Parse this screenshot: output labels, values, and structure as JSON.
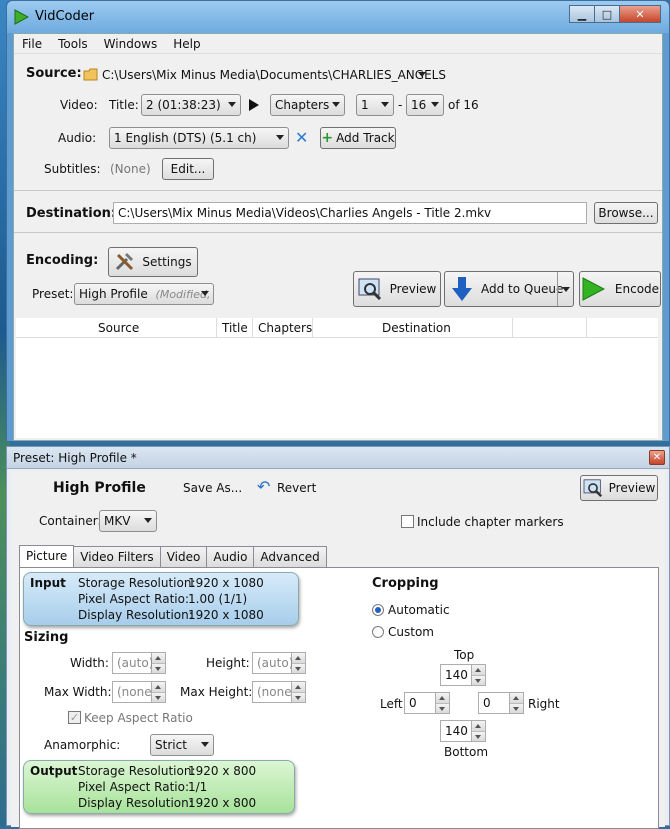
{
  "window": {
    "title": "VidCoder",
    "minimize": "▁",
    "maximize": "□",
    "close": "✕"
  },
  "menu": [
    "File",
    "Tools",
    "Windows",
    "Help"
  ],
  "source": {
    "label": "Source:",
    "path": "C:\\Users\\Mix Minus Media\\Documents\\CHARLIES_ANGELS"
  },
  "video": {
    "label": "Video:",
    "title_label": "Title:",
    "title_value": "2 (01:38:23)",
    "range_type": "Chapters",
    "start": "1",
    "dash": "-",
    "end": "16",
    "of_text": "of 16"
  },
  "audio": {
    "label": "Audio:",
    "track": "1 English (DTS) (5.1 ch)",
    "add_track": "Add Track"
  },
  "subtitles": {
    "label": "Subtitles:",
    "value": "(None)",
    "edit": "Edit..."
  },
  "destination": {
    "label": "Destination:",
    "path": "C:\\Users\\Mix Minus Media\\Videos\\Charlies Angels - Title 2.mkv",
    "browse": "Browse..."
  },
  "encoding": {
    "label": "Encoding:",
    "settings": "Settings",
    "preset_label": "Preset:",
    "preset_value": "High Profile",
    "preset_modified": "(Modified,",
    "preview": "Preview",
    "add_to_queue": "Add to Queue",
    "encode": "Encode"
  },
  "queue_columns": [
    "Source",
    "Title",
    "Chapters",
    "Destination"
  ],
  "preset_window": {
    "title": "Preset: High Profile *",
    "close": "✕",
    "name": "High Profile",
    "save_as": "Save As...",
    "revert": "Revert",
    "preview": "Preview",
    "container_label": "Container:",
    "container_value": "MKV",
    "chapter_markers": "Include chapter markers",
    "tabs": [
      "Picture",
      "Video Filters",
      "Video",
      "Audio",
      "Advanced"
    ],
    "input": {
      "title": "Input",
      "rows": [
        {
          "k": "Storage Resolution:",
          "v": "1920 x 1080"
        },
        {
          "k": "Pixel Aspect Ratio:",
          "v": "1.00 (1/1)"
        },
        {
          "k": "Display Resolution:",
          "v": "1920 x 1080"
        }
      ]
    },
    "sizing": {
      "title": "Sizing",
      "width_label": "Width:",
      "width_value": "(auto)",
      "height_label": "Height:",
      "height_value": "(auto)",
      "max_width_label": "Max Width:",
      "max_width_value": "(none)",
      "max_height_label": "Max Height:",
      "max_height_value": "(none)",
      "keep_aspect": "Keep Aspect Ratio",
      "anamorphic_label": "Anamorphic:",
      "anamorphic_value": "Strict"
    },
    "output": {
      "title": "Output",
      "rows": [
        {
          "k": "Storage Resolution:",
          "v": "1920 x 800"
        },
        {
          "k": "Pixel Aspect Ratio:",
          "v": "1/1"
        },
        {
          "k": "Display Resolution:",
          "v": "1920 x 800"
        }
      ]
    },
    "cropping": {
      "title": "Cropping",
      "automatic": "Automatic",
      "custom": "Custom",
      "top_label": "Top",
      "top": "140",
      "left_label": "Left",
      "left": "0",
      "right_label": "Right",
      "right": "0",
      "bottom_label": "Bottom",
      "bottom": "140"
    }
  }
}
